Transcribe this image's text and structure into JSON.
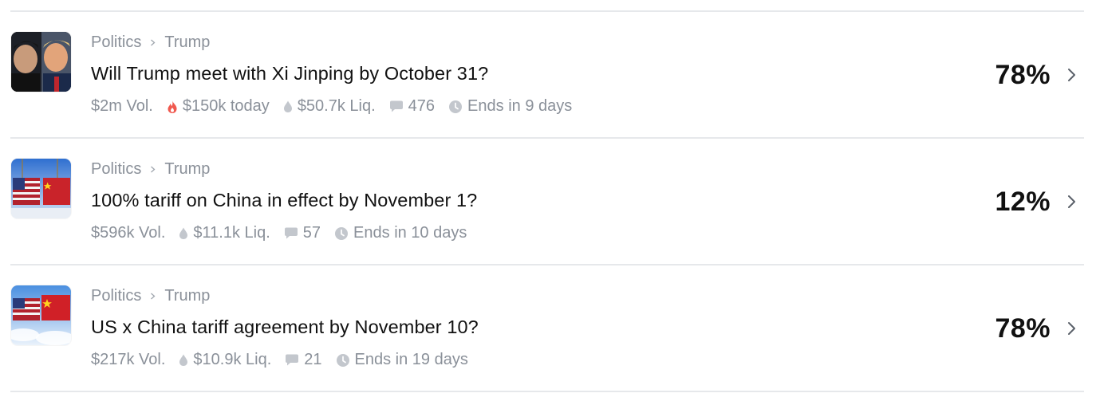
{
  "markets": [
    {
      "category": "Politics",
      "subcategory": "Trump",
      "title": "Will Trump meet with Xi Jinping by October 31?",
      "volume": "$2m Vol.",
      "today": "$150k today",
      "liquidity": "$50.7k Liq.",
      "comments": "476",
      "ends": "Ends in 9 days",
      "percent": "78%",
      "image": "trump-xi-photo"
    },
    {
      "category": "Politics",
      "subcategory": "Trump",
      "title": "100% tariff on China in effect by November 1?",
      "volume": "$596k Vol.",
      "liquidity": "$11.1k Liq.",
      "comments": "57",
      "ends": "Ends in 10 days",
      "percent": "12%",
      "image": "shipping-containers-flags"
    },
    {
      "category": "Politics",
      "subcategory": "Trump",
      "title": "US x China tariff agreement by November 10?",
      "volume": "$217k Vol.",
      "liquidity": "$10.9k Liq.",
      "comments": "21",
      "ends": "Ends in 19 days",
      "percent": "78%",
      "image": "flag-containers-sky"
    }
  ],
  "colors": {
    "muted": "#8a9099",
    "fire": "#f0594f",
    "divider": "#e6e8eb"
  }
}
